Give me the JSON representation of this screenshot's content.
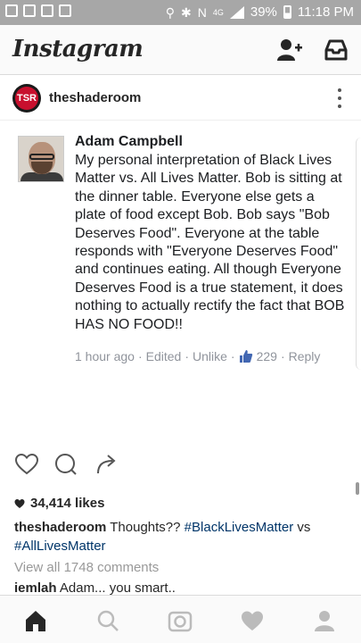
{
  "status_bar": {
    "battery": "39%",
    "time": "11:18 PM",
    "network": "4G"
  },
  "header": {
    "logo": "Instagram"
  },
  "post": {
    "username": "theshaderoom",
    "avatar_text": "TSR",
    "image_comment": {
      "author": "Adam Campbell",
      "text": "My personal interpretation of Black Lives Matter vs. All Lives Matter. Bob is sitting at the dinner table. Everyone else gets a plate of food except Bob. Bob says \"Bob Deserves Food\". Everyone at the table responds with \"Everyone Deserves Food\" and continues eating. All though Everyone Deserves Food is a true statement, it does nothing to actually rectify the fact that BOB HAS NO FOOD!!",
      "time": "1 hour ago",
      "edited": "Edited",
      "unlike": "Unlike",
      "like_count": "229",
      "reply": "Reply",
      "separator": "·"
    },
    "likes": "34,414 likes",
    "caption": {
      "username": "theshaderoom",
      "text_before": "Thoughts??",
      "tag1": "#BlackLivesMatter",
      "middle": "vs",
      "tag2": "#AllLivesMatter"
    },
    "view_comments": "View all 1748 comments",
    "comment": {
      "username": "iemlah",
      "text": "Adam... you smart.."
    }
  },
  "icons": {
    "add_user": "add-user-icon",
    "inbox": "inbox-icon",
    "more": "more-vertical-icon",
    "like": "heart-icon",
    "comment": "comment-icon",
    "share": "share-icon",
    "home": "home-icon",
    "search": "search-icon",
    "camera": "camera-icon",
    "activity": "heart-icon",
    "profile": "profile-icon"
  },
  "colors": {
    "hashtag": "#003569",
    "fb_blue": "#4267b2",
    "status_bar": "#a7a7a7"
  }
}
